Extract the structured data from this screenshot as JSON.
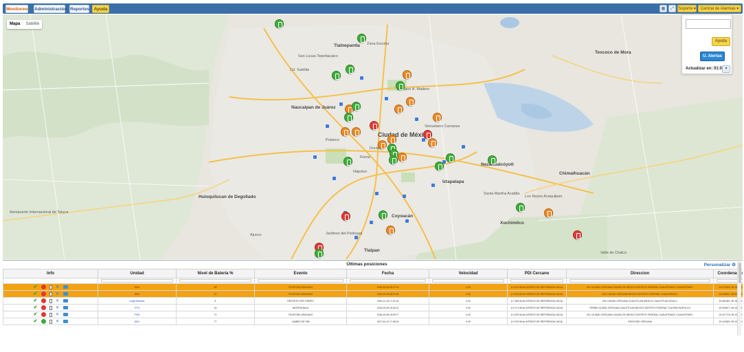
{
  "nav": {
    "tabs": [
      {
        "label": "Monitoreo",
        "active": true
      },
      {
        "label": "Administración",
        "active": false
      },
      {
        "label": "Reportes",
        "active": false
      },
      {
        "label": "Ayuda",
        "active": false,
        "style": "yellow"
      }
    ],
    "right": {
      "soporte": "Soporte ▾",
      "central": "Central de Alarmas ▾"
    }
  },
  "map": {
    "type_options": [
      "Mapa",
      "Satélite"
    ],
    "selected_type": "Mapa",
    "labels": {
      "mexico_city": "Ciudad de México",
      "tlalnepantla": "Tlalnepantla",
      "naucalpan": "Naucalpan de Juárez",
      "nezahualcoyotl": "Nezahualcóyotl",
      "chimalhuacan": "Chimalhuacán",
      "texcoco": "Texcoco de Mora",
      "huixquilucan": "Huixquilucan de Degollado",
      "coyoacan": "Coyoacán",
      "iztapalapa": "Iztapalapa",
      "tlalpan": "Tlalpan",
      "xochimilco": "Xochimilco",
      "toluca": "Aeropuerto Internacional de Toluca",
      "gustavo_madero": "Gustavo A. Madero",
      "venustiano": "Venustiano Carranza",
      "zona_escolar": "Zona Escolar",
      "san_lucas": "San Lucas Tepetlacalco",
      "satelite": "Cd. Satélite",
      "polanco": "Polanco",
      "roma": "Roma",
      "doctores": "Doctores",
      "napoles": "Nápoles",
      "pedregal": "Jardines del Pedregal",
      "ajusco": "Ajusco",
      "culhuacan": "Santa Martha Acatitla",
      "los_reyes": "Los Reyes Acaquilpan",
      "chalco": "Valle de Chalco"
    }
  },
  "sidepanel": {
    "search_value": "",
    "ayuda_label": "Ayuda",
    "alertas_label": "U. Alertas",
    "refresh_label": "Actualizar en: 01:05",
    "refresh_btn": "▾"
  },
  "table": {
    "title": "Últimas posiciones",
    "personalizar": "Personalizar ⚙",
    "headers": [
      "Info",
      "Unidad",
      "Nivel de Batería %",
      "Evento",
      "Fecha",
      "Velocidad",
      "PDI Cercano",
      "Direccion",
      "Coordenadas"
    ],
    "rows": [
      {
        "highlight": true,
        "status": "red",
        "unidad": "8949",
        "bateria": "68",
        "evento": "TELEFONO APAGADO",
        "fecha": "2016-09-08 08:27:00",
        "velocidad": "0.00",
        "pdi": "A 3.14 KM de INTENTO DE REFERENCIA VACIA",
        "direccion": "001 CIUDAD CERCANA CIUDAD DE MEXICO DISTRITO FEDERAL CUAUHTEMOC CUAUHTEMOC",
        "coordenadas": "19.373246,-99.186783"
      },
      {
        "highlight": true,
        "status": "red",
        "unidad": "8805",
        "bateria": "47",
        "evento": "TELEFONO APAGADO",
        "fecha": "2016-09-08 08:27:35",
        "velocidad": "0.00",
        "pdi": "A 3.29 KM de INTENTO DE REFERENCIA VACIA",
        "direccion": "001 CIUDAD CERCANA MEXICO DISTRITO FEDERAL CUAUHTEMOC",
        "coordenadas": "19.406624,-99.067889"
      },
      {
        "highlight": false,
        "status": "red",
        "unidad": "Angel Bautista",
        "bateria": "8",
        "evento": "REPORTE POR TIEMPO",
        "fecha": "2016-11-15 17:10:18",
        "velocidad": "0.00",
        "pdi": "A 7.98 KM de INTENTO DE REFERENCIA VACIA",
        "direccion": "001 CIUDAD CERCANA CUAUTITLAN MEXICO CUAUTITLAN IZCALLI",
        "coordenadas": "19.662481,-99.188654"
      },
      {
        "highlight": false,
        "status": "red",
        "unidad": "TP21",
        "bateria": "16",
        "evento": "BATERIA BAJA",
        "fecha": "2016-09-08 15:26:12",
        "velocidad": "0.00",
        "pdi": "A 0.71 KM de INTENTO DE REFERENCIA VACIA",
        "direccion": "TERMN CIUDAD CERCANA CUAUTITLAN MEXICO DISTRITO FEDERAL TLALPAN HUIPULCO",
        "coordenadas": "19.304677,-99.157093"
      },
      {
        "highlight": false,
        "status": "red",
        "unidad": "PF81",
        "bateria": "72",
        "evento": "TELEFONO APAGADO",
        "fecha": "2016-09-08 15:09:77",
        "velocidad": "0.00",
        "pdi": "A 3.29 KM de INTENTO DE REFERENCIA VACIA",
        "direccion": "001 CIUDAD CERCANA CIUDAD DE MEXICO DISTRITO FEDERAL CUAUHTEMOC CUAUHTEMOC",
        "coordenadas": "19.417715,-99.136660"
      },
      {
        "highlight": false,
        "status": "green",
        "unidad": "8401",
        "bateria": "77",
        "evento": "CAMBIO DE SIM",
        "fecha": "2017-04-12 17:46:24",
        "velocidad": "0.00",
        "pdi": "A 3.23 KM de INTENTO DE REFERENCIA VACIA",
        "direccion": "GEOCODE CERCANA",
        "coordenadas": "19.419481,-99.137200"
      }
    ]
  },
  "colors": {
    "nav": "#3a6fa8",
    "highlight_row": "#f2a212",
    "marker_green": "#3fae3a",
    "marker_orange": "#f08a24",
    "marker_red": "#e23a35"
  }
}
